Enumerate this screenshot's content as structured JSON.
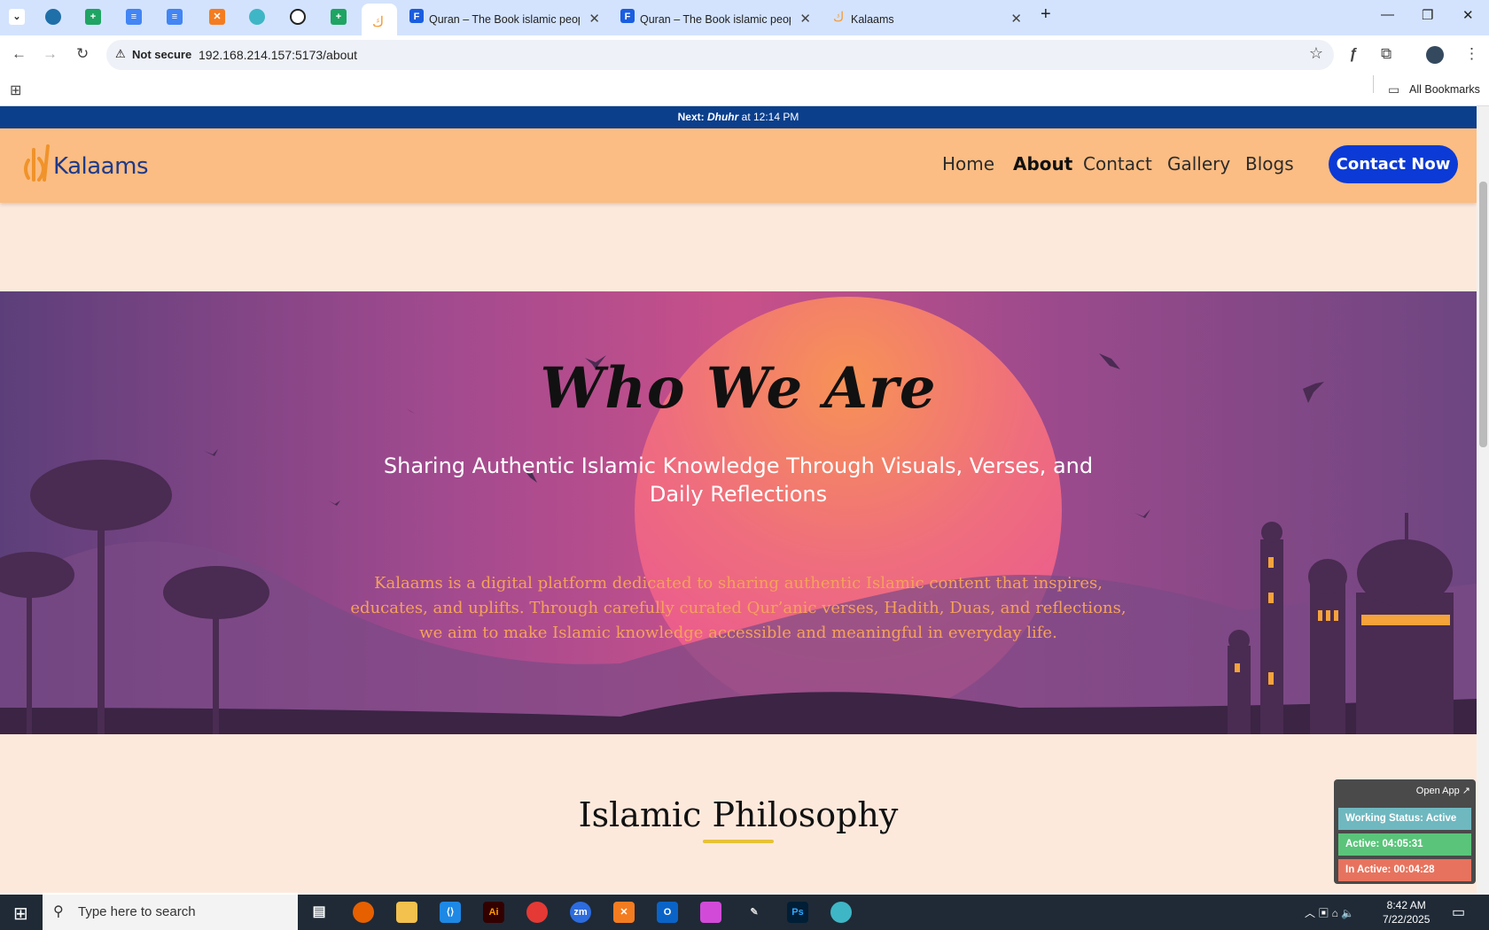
{
  "browser": {
    "tabs": [
      {
        "title": "Quran – The Book islamic peopl",
        "close": "✕"
      },
      {
        "title": "Quran – The Book islamic peopl",
        "close": "✕"
      },
      {
        "title": "Kalaams",
        "close": "✕"
      }
    ],
    "new_tab": "+",
    "security": "Not secure",
    "url": "192.168.214.157:5173/about",
    "bookmarks_label": "All Bookmarks"
  },
  "site": {
    "prayer_prefix": "Next:",
    "prayer_name": "Dhuhr",
    "prayer_time": "at 12:14 PM",
    "brand": "Kalaams",
    "nav": [
      "Home",
      "About",
      "Contact",
      "Gallery",
      "Blogs"
    ],
    "cta": "Contact Now",
    "hero": {
      "title": "Who We Are",
      "subtitle": "Sharing Authentic Islamic Knowledge Through Visuals, Verses, and Daily Reflections",
      "description": "Kalaams is a digital platform dedicated to sharing authentic Islamic content that inspires, educates, and uplifts. Through carefully curated Qur’anic verses, Hadith, Duas, and reflections, we aim to make Islamic knowledge accessible and meaningful in everyday life."
    },
    "section_title": "Islamic Philosophy"
  },
  "widget": {
    "open": "Open App ↗",
    "status": "Working Status: Active",
    "active": "Active: 04:05:31",
    "inactive": "In Active: 00:04:28"
  },
  "taskbar": {
    "search": "Type here to search",
    "time": "8:42 AM",
    "date": "7/22/2025"
  },
  "colors": {
    "prayer_bar": "#0b3f8c",
    "nav": "#fbbd83",
    "cta": "#0b3ad6",
    "page_bg": "#fde9dc"
  }
}
